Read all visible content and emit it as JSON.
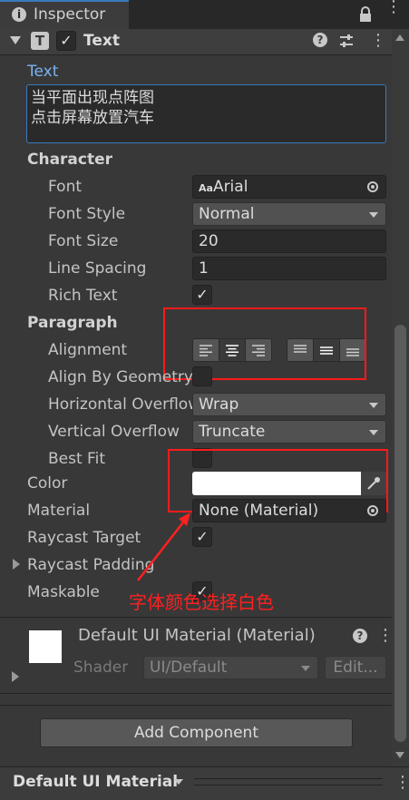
{
  "tab": {
    "title": "Inspector"
  },
  "component": {
    "title": "Text"
  },
  "text_section": {
    "label": "Text",
    "value_line1": "当平面出现点阵图",
    "value_line2": "点击屏幕放置汽车"
  },
  "character": {
    "heading": "Character",
    "font_label": "Font",
    "font_value": "Arial",
    "font_prefix": "Aa",
    "font_style_label": "Font Style",
    "font_style_value": "Normal",
    "font_size_label": "Font Size",
    "font_size_value": "20",
    "line_spacing_label": "Line Spacing",
    "line_spacing_value": "1",
    "rich_text_label": "Rich Text"
  },
  "paragraph": {
    "heading": "Paragraph",
    "alignment_label": "Alignment",
    "align_by_geometry_label": "Align By Geometry",
    "horizontal_overflow_label": "Horizontal Overflow",
    "horizontal_overflow_value": "Wrap",
    "vertical_overflow_label": "Vertical Overflow",
    "vertical_overflow_value": "Truncate",
    "best_fit_label": "Best Fit"
  },
  "color": {
    "label": "Color",
    "swatch": "#ffffff"
  },
  "material": {
    "label": "Material",
    "value": "None (Material)"
  },
  "raycast_target_label": "Raycast Target",
  "raycast_padding_label": "Raycast Padding",
  "maskable_label": "Maskable",
  "annotation": {
    "text": "字体颜色选择白色",
    "color": "#ff2020"
  },
  "material_panel": {
    "title": "Default UI Material (Material)",
    "shader_label": "Shader",
    "shader_value": "UI/Default",
    "edit_label": "Edit..."
  },
  "add_component_label": "Add Component",
  "footer": {
    "label": "Default UI Material"
  }
}
